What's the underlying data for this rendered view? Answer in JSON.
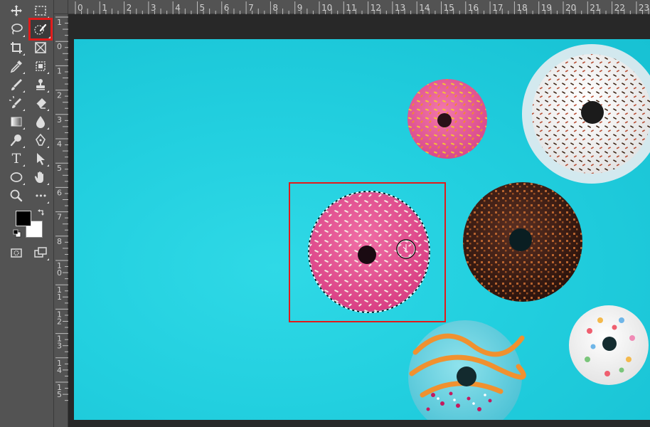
{
  "toolbar": {
    "tools": [
      {
        "name": "move-tool",
        "icon": "move-icon"
      },
      {
        "name": "rectangular-marquee-tool",
        "icon": "marquee-icon"
      },
      {
        "name": "lasso-tool",
        "icon": "lasso-icon"
      },
      {
        "name": "quick-selection-tool",
        "icon": "quick-selection-icon",
        "selected": true
      },
      {
        "name": "crop-tool",
        "icon": "crop-icon"
      },
      {
        "name": "frame-tool",
        "icon": "frame-icon"
      },
      {
        "name": "eyedropper-tool",
        "icon": "eyedropper-icon"
      },
      {
        "name": "spot-healing-tool",
        "icon": "patch-icon"
      },
      {
        "name": "brush-tool",
        "icon": "brush-icon"
      },
      {
        "name": "clone-stamp-tool",
        "icon": "stamp-icon"
      },
      {
        "name": "history-brush-tool",
        "icon": "history-brush-icon"
      },
      {
        "name": "eraser-tool",
        "icon": "eraser-icon"
      },
      {
        "name": "gradient-tool",
        "icon": "gradient-icon"
      },
      {
        "name": "blur-tool",
        "icon": "drop-icon"
      },
      {
        "name": "dodge-tool",
        "icon": "dodge-icon"
      },
      {
        "name": "pen-tool",
        "icon": "pen-icon"
      },
      {
        "name": "type-tool",
        "icon": "type-icon",
        "label": "T"
      },
      {
        "name": "path-selection-tool",
        "icon": "arrow-icon"
      },
      {
        "name": "ellipse-tool",
        "icon": "ellipse-icon"
      },
      {
        "name": "hand-tool",
        "icon": "hand-icon"
      },
      {
        "name": "zoom-tool",
        "icon": "zoom-icon"
      },
      {
        "name": "more-tools",
        "icon": "ellipsis-icon",
        "label": "•••"
      },
      {
        "name": "quick-mask-mode",
        "icon": "quick-mask-icon"
      },
      {
        "name": "screen-mode",
        "icon": "screen-mode-icon"
      }
    ],
    "foreground_color": "#000000",
    "background_color": "#ffffff",
    "selected_highlight_color": "#e11b1b"
  },
  "rulers": {
    "horizontal_labels": [
      "0",
      "1",
      "2",
      "3",
      "4",
      "5",
      "6",
      "7",
      "8",
      "9",
      "10",
      "11",
      "12",
      "13",
      "14",
      "15",
      "16",
      "17",
      "18",
      "19",
      "20",
      "21",
      "22",
      "23"
    ],
    "vertical_labels": [
      "1",
      "0",
      "1",
      "2",
      "3",
      "4",
      "5",
      "6",
      "7",
      "8",
      "1 0",
      "1 1",
      "1 2",
      "1 3",
      "1 4",
      "1 5"
    ]
  },
  "canvas": {
    "background_color": "#22cfdf",
    "highlight_color": "#e11b1b"
  }
}
